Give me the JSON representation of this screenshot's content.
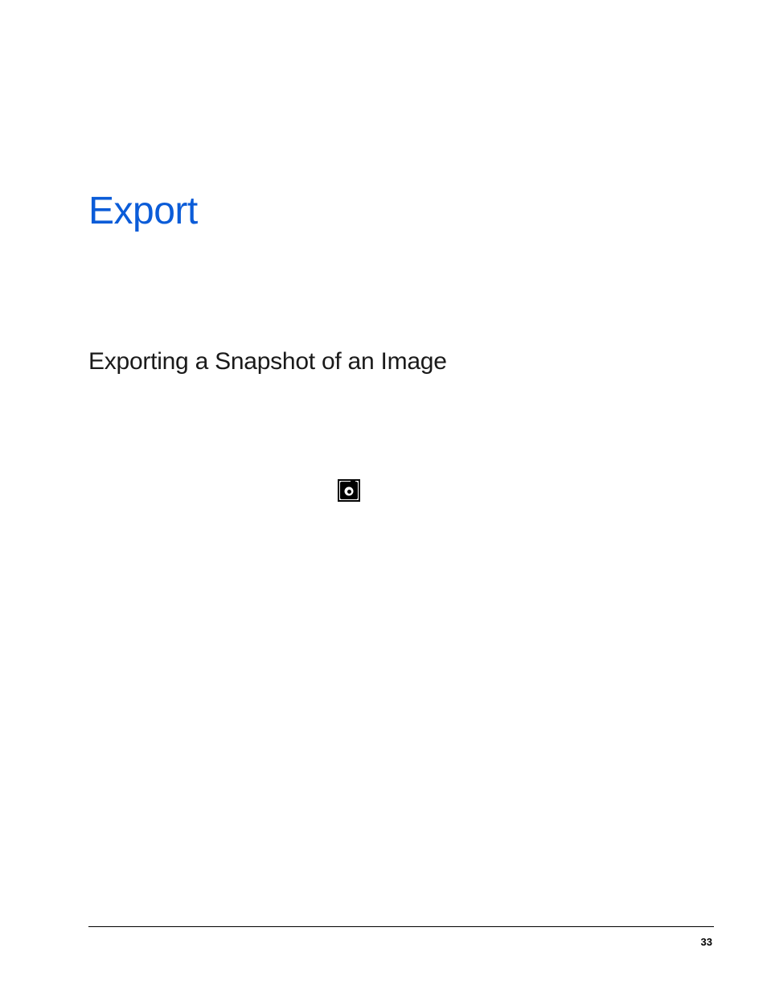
{
  "chapter": {
    "title": "Export"
  },
  "section": {
    "title": "Exporting a Snapshot of an Image"
  },
  "page_number": "33",
  "icons": {
    "snapshot": "camera-icon"
  },
  "colors": {
    "heading_blue": "#0b5cd8"
  }
}
